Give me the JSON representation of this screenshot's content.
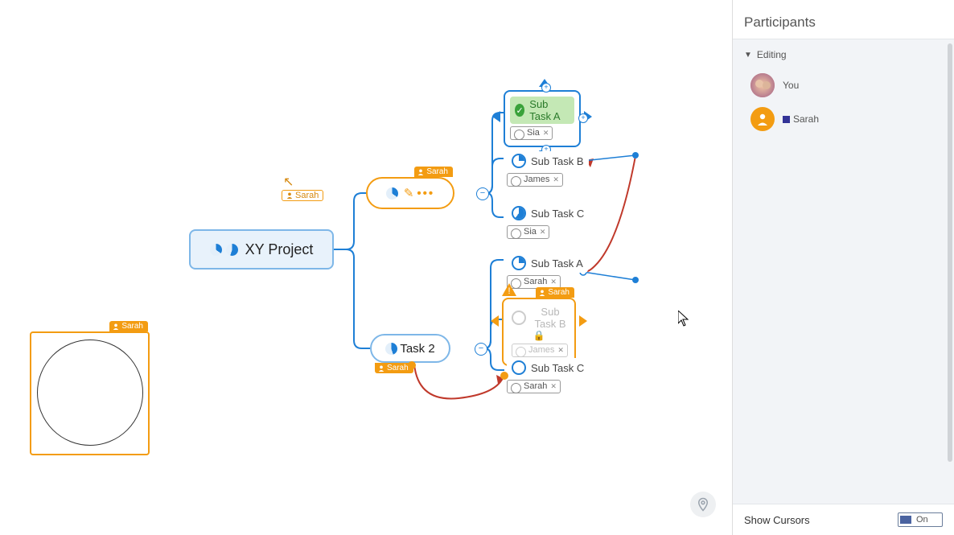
{
  "panel": {
    "title": "Participants",
    "section": "Editing",
    "participants": [
      {
        "name": "You",
        "color": "photo"
      },
      {
        "name": "Sarah",
        "color": "orange"
      }
    ],
    "show_cursors_label": "Show Cursors",
    "toggle_state": "On"
  },
  "mindmap": {
    "root": "XY Project",
    "task1": {
      "editor_tag": "Sarah",
      "children": [
        {
          "name": "Sub Task A",
          "assignee": "Sia",
          "progress": 100,
          "selected": true
        },
        {
          "name": "Sub Task B",
          "assignee": "James",
          "progress": 25
        },
        {
          "name": "Sub Task C",
          "assignee": "Sia",
          "progress": 60
        }
      ]
    },
    "task2": {
      "label": "Task 2",
      "editor_tag": "Sarah",
      "children": [
        {
          "name": "Sub Task A",
          "assignee": "Sarah",
          "progress": 25
        },
        {
          "name": "Sub Task B",
          "assignee": "James",
          "progress": 0,
          "locked": true,
          "locked_by": "Sarah"
        },
        {
          "name": "Sub Task C",
          "assignee": "Sarah",
          "progress": 0
        }
      ]
    },
    "shape_box_tag": "Sarah",
    "floating_cursor_tag": "Sarah",
    "collapse_glyph": "−"
  },
  "icons": {
    "person": "person-icon",
    "check": "✓",
    "plus": "+",
    "lock": "🔒",
    "location": "◎"
  }
}
